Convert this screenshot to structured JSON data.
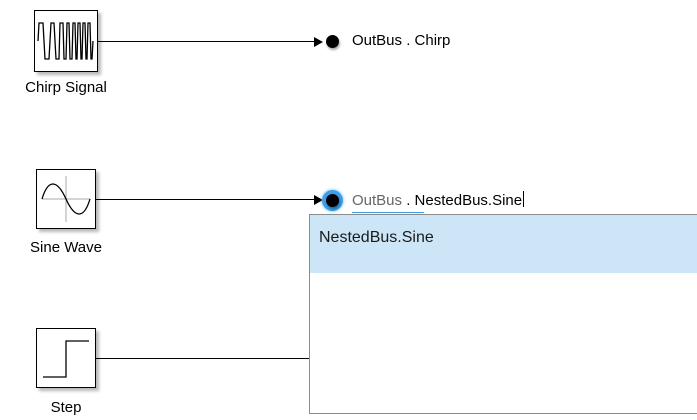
{
  "blocks": {
    "chirp": {
      "label": "Chirp Signal",
      "port_name": "OutBus . Chirp"
    },
    "sine": {
      "label": "Sine Wave"
    },
    "step": {
      "label": "Step"
    }
  },
  "edit": {
    "prefix": "OutBus",
    "separator": " . ",
    "value": "NestedBus.Sine"
  },
  "autocomplete": {
    "items": [
      "NestedBus.Sine"
    ]
  },
  "colors": {
    "highlight_ring": "#3d9ee6",
    "selected_item_bg": "#cde6f7"
  }
}
